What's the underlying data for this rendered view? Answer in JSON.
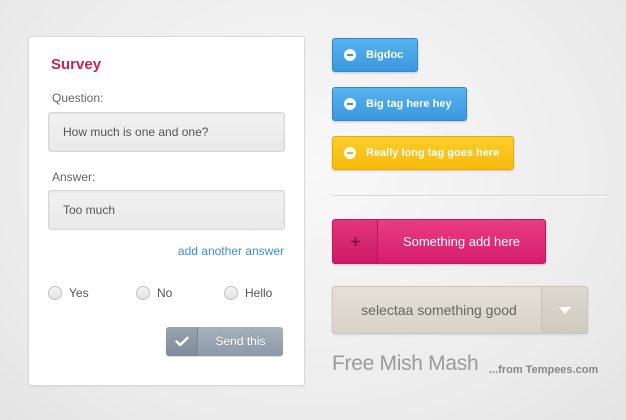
{
  "survey": {
    "title": "Survey",
    "question_label": "Question:",
    "question_value": "How much is one and one?",
    "answer_label": "Answer:",
    "answer_value": "Too much",
    "add_answer_link": "add another answer",
    "options": [
      "Yes",
      "No",
      "Hello"
    ],
    "send_label": "Send this"
  },
  "tags": [
    {
      "label": "Bigdoc",
      "color": "#3a98de"
    },
    {
      "label": "Big tag here hey",
      "color": "#3a98de"
    },
    {
      "label": "Really long tag goes here",
      "color": "#f7b90c"
    }
  ],
  "add_button": {
    "label": "Something add here",
    "color": "#d51e6c"
  },
  "select": {
    "value": "selectaa something good"
  },
  "footer": {
    "title": "Free Mish Mash",
    "credit": "...from Tempees.com"
  },
  "icons": {
    "check": "check-icon",
    "minus": "minus-icon",
    "plus": "plus-icon",
    "dropdown": "chevron-down-icon"
  }
}
